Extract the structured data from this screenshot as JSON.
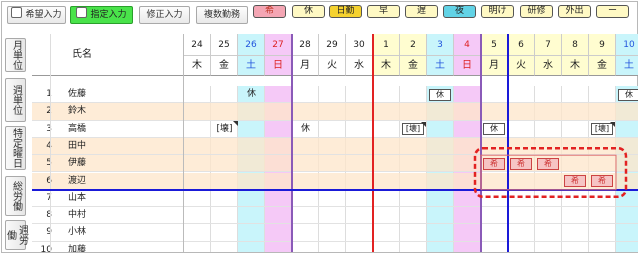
{
  "toolbar": {
    "buttons": [
      {
        "label": "希望入力",
        "has_check": true,
        "active": false
      },
      {
        "label": "指定入力",
        "has_check": true,
        "active": true
      },
      {
        "label": "修正入力",
        "has_check": false,
        "active": false
      },
      {
        "label": "複数勤務",
        "has_check": false,
        "active": false
      }
    ],
    "pills": [
      {
        "label": "希",
        "bg": "#f4a6b4",
        "fg": "#c0392b"
      },
      {
        "label": "休",
        "bg": "#fff9c4",
        "fg": "#222222"
      },
      {
        "label": "日勤",
        "bg": "#f5d22f",
        "fg": "#222222"
      },
      {
        "label": "早",
        "bg": "#fff9c4",
        "fg": "#222222"
      },
      {
        "label": "遅",
        "bg": "#fff9c4",
        "fg": "#222222"
      },
      {
        "label": "夜",
        "bg": "#62d3e6",
        "fg": "#222222"
      },
      {
        "label": "明け",
        "bg": "#fff9c4",
        "fg": "#222222"
      },
      {
        "label": "研修",
        "bg": "#fff9c4",
        "fg": "#222222"
      },
      {
        "label": "外出",
        "bg": "#fff9c4",
        "fg": "#222222"
      },
      {
        "label": "ー",
        "bg": "#fff9c4",
        "fg": "#222222"
      }
    ]
  },
  "side_nav": [
    {
      "label": "月単位"
    },
    {
      "label": "週単位"
    },
    {
      "label": "特定曜日"
    },
    {
      "label": "総労働"
    },
    {
      "label": "週労働"
    }
  ],
  "grid": {
    "name_header": "氏名",
    "days": [
      {
        "num": "24",
        "dow": "木",
        "type": "wk",
        "month": "prev"
      },
      {
        "num": "25",
        "dow": "金",
        "type": "wk",
        "month": "prev"
      },
      {
        "num": "26",
        "dow": "土",
        "type": "sat",
        "month": "prev"
      },
      {
        "num": "27",
        "dow": "日",
        "type": "sun",
        "month": "prev"
      },
      {
        "num": "28",
        "dow": "月",
        "type": "wk",
        "month": "prev"
      },
      {
        "num": "29",
        "dow": "火",
        "type": "wk",
        "month": "prev"
      },
      {
        "num": "30",
        "dow": "水",
        "type": "wk",
        "month": "prev"
      },
      {
        "num": "1",
        "dow": "木",
        "type": "wk",
        "month": "cur"
      },
      {
        "num": "2",
        "dow": "金",
        "type": "wk",
        "month": "cur"
      },
      {
        "num": "3",
        "dow": "土",
        "type": "sat",
        "month": "cur"
      },
      {
        "num": "4",
        "dow": "日",
        "type": "sun",
        "month": "cur"
      },
      {
        "num": "5",
        "dow": "月",
        "type": "wk",
        "month": "cur"
      },
      {
        "num": "6",
        "dow": "火",
        "type": "wk",
        "month": "cur"
      },
      {
        "num": "7",
        "dow": "水",
        "type": "wk",
        "month": "cur"
      },
      {
        "num": "8",
        "dow": "木",
        "type": "wk",
        "month": "cur"
      },
      {
        "num": "9",
        "dow": "金",
        "type": "wk",
        "month": "cur"
      },
      {
        "num": "10",
        "dow": "土",
        "type": "sat",
        "month": "cur"
      }
    ],
    "rows": [
      {
        "no": "1",
        "name": "佐藤"
      },
      {
        "no": "2",
        "name": "鈴木"
      },
      {
        "no": "3",
        "name": "高橋"
      },
      {
        "no": "4",
        "name": "田中"
      },
      {
        "no": "5",
        "name": "伊藤"
      },
      {
        "no": "6",
        "name": "渡辺"
      },
      {
        "no": "7",
        "name": "山本"
      },
      {
        "no": "8",
        "name": "中村"
      },
      {
        "no": "9",
        "name": "小林"
      },
      {
        "no": "10",
        "name": "加藤"
      }
    ],
    "entries": [
      {
        "row": 0,
        "day": 2,
        "label": "休",
        "style": "plain"
      },
      {
        "row": 0,
        "day": 9,
        "label": "休",
        "style": "boxed"
      },
      {
        "row": 0,
        "day": 16,
        "label": "休",
        "style": "boxed"
      },
      {
        "row": 2,
        "day": 1,
        "label": "[壊]",
        "style": "plain"
      },
      {
        "row": 2,
        "day": 4,
        "label": "休",
        "style": "plain"
      },
      {
        "row": 2,
        "day": 8,
        "label": "[壊]",
        "style": "boxed"
      },
      {
        "row": 2,
        "day": 11,
        "label": "休",
        "style": "boxed"
      },
      {
        "row": 2,
        "day": 15,
        "label": "[壊]",
        "style": "boxed"
      },
      {
        "row": 4,
        "day": 11,
        "label": "希",
        "style": "red"
      },
      {
        "row": 4,
        "day": 12,
        "label": "希",
        "style": "red"
      },
      {
        "row": 4,
        "day": 13,
        "label": "希",
        "style": "red"
      },
      {
        "row": 5,
        "day": 14,
        "label": "希",
        "style": "red"
      },
      {
        "row": 5,
        "day": 15,
        "label": "希",
        "style": "red"
      }
    ]
  },
  "colors": {
    "sat_col": "#c9f5fb",
    "sun_col": "#f5c9f7",
    "row_highlight": "#fde6c9",
    "current_month_header": "#fffdd0",
    "accent_red": "#e22222",
    "accent_blue": "#1a1ad8"
  }
}
